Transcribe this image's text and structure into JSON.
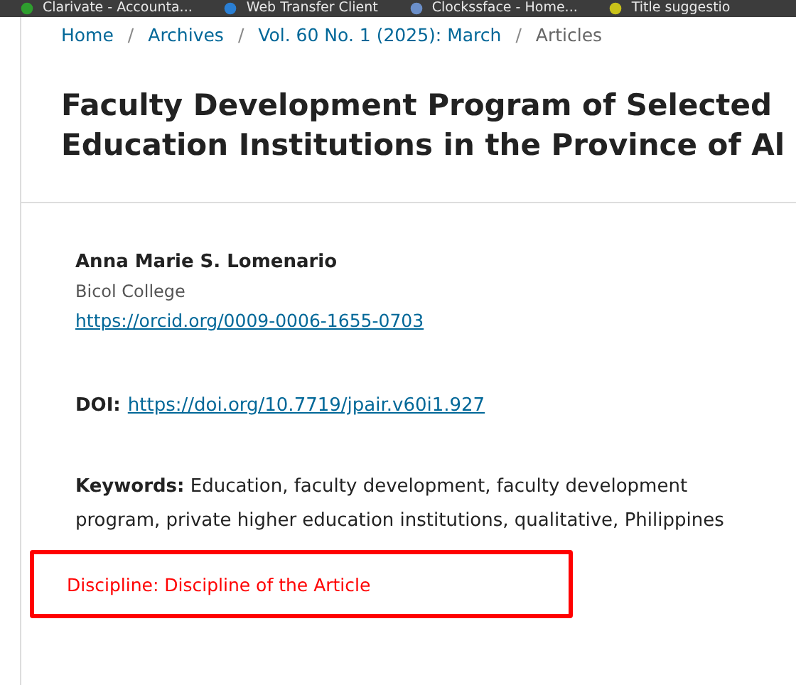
{
  "bookmarks": [
    {
      "label": "Clarivate - Accounta..."
    },
    {
      "label": "Web Transfer Client"
    },
    {
      "label": "Clockssface - Home..."
    },
    {
      "label": "Title suggestio"
    }
  ],
  "breadcrumbs": [
    {
      "label": "Home",
      "current": false
    },
    {
      "label": "Archives",
      "current": false
    },
    {
      "label": "Vol. 60 No. 1 (2025): March",
      "current": false
    },
    {
      "label": "Articles",
      "current": true
    }
  ],
  "breadcrumb_separator": "/",
  "article": {
    "title_lines": [
      "Faculty Development Program of Selected",
      "Education Institutions in the Province of Al"
    ],
    "author": {
      "name": "Anna Marie S. Lomenario",
      "affiliation": "Bicol College",
      "orcid": "https://orcid.org/0009-0006-1655-0703"
    },
    "doi": {
      "label": "DOI:",
      "link": "https://doi.org/10.7719/jpair.v60i1.927"
    },
    "keywords": {
      "label": "Keywords:",
      "text": "Education, faculty development, faculty development program, private higher education institutions, qualitative, Philippines"
    },
    "discipline": "Discipline: Discipline of the Article"
  }
}
